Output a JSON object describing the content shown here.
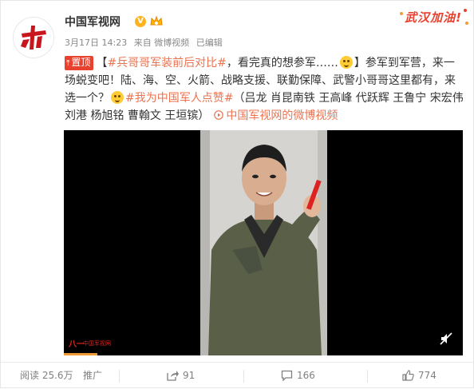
{
  "account": {
    "name": "中国军视网",
    "verified_badge": "V",
    "avatar_text": "八一"
  },
  "meta": {
    "date": "3月17日 14:23",
    "source": "来自 微博视频",
    "edited": "已编辑"
  },
  "promo": {
    "text": "武汉加油!"
  },
  "post": {
    "pin_label": "置顶",
    "bracket_open": "【",
    "hashtag1": "#兵哥哥军装前后对比#",
    "text1": "，看完真的想参军……",
    "text2": "】参军到军营，来一场蜕变吧！陆、海、空、火箭、战略支援、联勤保障、武警小哥哥这里都有，来选一个？",
    "hashtag2": "#我为中国军人点赞#",
    "text3": "（吕龙 肖昆南铁 王高峰 代跃辉 王鲁宁 宋宏伟 刘港 杨旭铭 曹翰文 王垣镔）",
    "video_link": "中国军视网的微博视频"
  },
  "video": {
    "progress_ratio": 0.084,
    "watermark": "八一",
    "watermark_small": "中国军视网"
  },
  "actions": {
    "reads": "阅读 25.6万",
    "promote": "推广",
    "shares": "91",
    "comments": "166",
    "likes": "774"
  },
  "colors": {
    "accent": "#eb7350",
    "pin": "#e8422f",
    "progress": "#f09a36"
  }
}
